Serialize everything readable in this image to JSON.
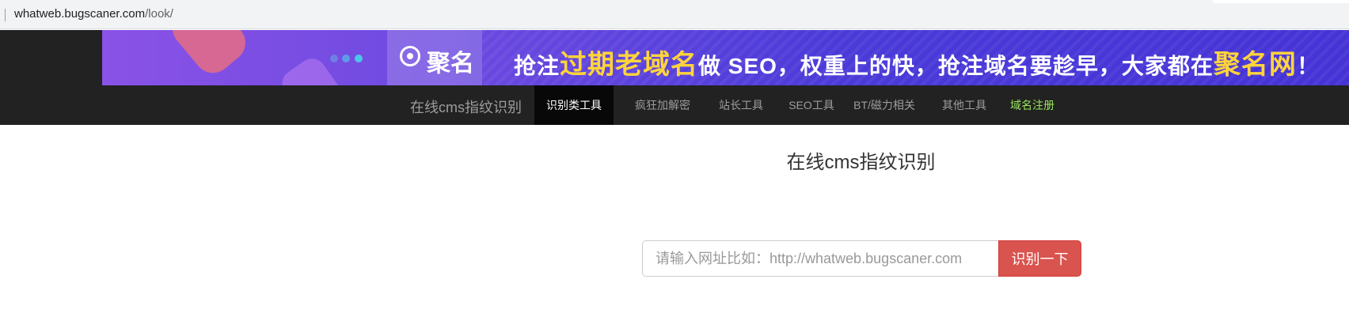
{
  "browser": {
    "url_host": "whatweb.bugscaner.com",
    "url_path": "/look/"
  },
  "banner": {
    "logo_text": "聚名",
    "slogan": {
      "part1": "抢注",
      "hl1": "过期老域名",
      "part2": "做 SEO，权重上的快，抢注域名要趁早，大家都在",
      "hl2": "聚名网",
      "end": "！"
    },
    "colors": {
      "highlight": "#ffd43b",
      "gradient_start": "#8a52e6",
      "gradient_end": "#4633d6"
    }
  },
  "nav": {
    "brand": "在线cms指纹识别",
    "items": [
      {
        "label": "识别类工具",
        "active": true
      },
      {
        "label": "疯狂加解密",
        "active": false
      },
      {
        "label": "站长工具",
        "active": false
      },
      {
        "label": "SEO工具",
        "active": false
      },
      {
        "label": "BT/磁力相关",
        "active": false
      },
      {
        "label": "其他工具",
        "active": false
      },
      {
        "label": "域名注册",
        "active": false
      }
    ]
  },
  "main": {
    "title": "在线cms指纹识别",
    "search": {
      "placeholder": "请输入网址比如：http://whatweb.bugscaner.com",
      "value": "",
      "button_label": "识别一下"
    }
  },
  "colors": {
    "navbar_bg": "#222222",
    "active_item_bg": "#080808",
    "button_bg": "#d9534f",
    "domain_link": "#99e65c"
  }
}
